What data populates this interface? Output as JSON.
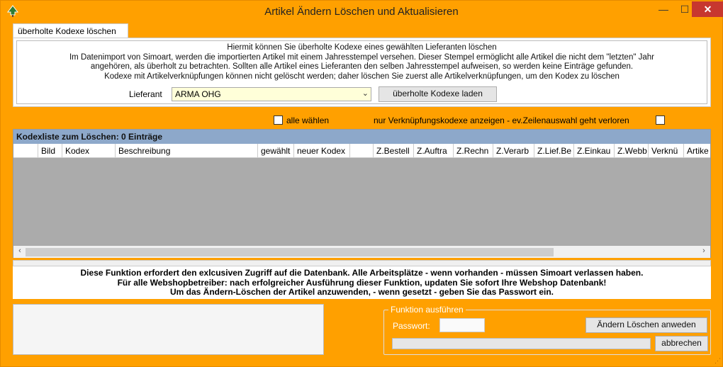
{
  "window": {
    "title": "Artikel Ändern Löschen und Aktualisieren",
    "min_glyph": "—",
    "max_glyph": "☐",
    "close_glyph": "✕"
  },
  "tab": {
    "label": "überholte Kodexe löschen"
  },
  "info_lines": [
    "Hiermit können Sie überholte Kodexe eines gewählten Lieferanten löschen",
    "Im Datenimport von Simoart, werden die importierten Artikel mit einem Jahresstempel versehen. Dieser Stempel ermöglicht alle Artikel die nicht dem \"letzten\" Jahr",
    "angehören, als überholt zu betrachten. Sollten alle Artikel eines Lieferanten den selben Jahresstempel aufweisen, so werden keine Einträge gefunden.",
    "Kodexe mit Artikelverknüpfungen können nicht gelöscht werden; daher löschen Sie zuerst alle Artikelverknüpfungen, um den Kodex zu löschen"
  ],
  "lieferant": {
    "label": "Lieferant",
    "value": "ARMA OHG"
  },
  "buttons": {
    "laden": "überholte Kodexe laden",
    "anwenden": "Ändern Löschen anweden",
    "abbrechen": "abbrechen"
  },
  "options": {
    "alle_waehlen": "alle wählen",
    "nur_verknuepfung": "nur Verknüpfungskodexe anzeigen - ev.Zeilenauswahl geht verloren"
  },
  "grid": {
    "caption": "Kodexliste zum Löschen: 0 Einträge",
    "columns": [
      "",
      "Bild",
      "Kodex",
      "Beschreibung",
      "gewählt",
      "neuer Kodex",
      "",
      "Z.Bestell",
      "Z.Auftra",
      "Z.Rechn",
      "Z.Verarb",
      "Z.Lief.Be",
      "Z.Einkau",
      "Z.Webb",
      "Verknü",
      "Artike"
    ]
  },
  "warning_lines": [
    "Diese Funktion erfordert den  exlcusiven Zugriff auf die Datenbank. Alle Arbeitsplätze - wenn vorhanden - müssen Simoart verlassen haben.",
    "Für alle Webshopbetreiber: nach erfolgreicher Ausführung dieser Funktion, updaten Sie sofort Ihre Webshop Datenbank!",
    "Um das Ändern-Löschen der Artikel anzuwenden, - wenn gesetzt - geben Sie das Passwort ein."
  ],
  "execute": {
    "legend": "Funktion ausführen",
    "password_label": "Passwort:",
    "password_value": ""
  },
  "colors": {
    "window_bg": "#FFA000",
    "caption_bg": "#8DA8CA",
    "close_bg": "#C7372F",
    "grid_bg": "#ABABAB"
  }
}
